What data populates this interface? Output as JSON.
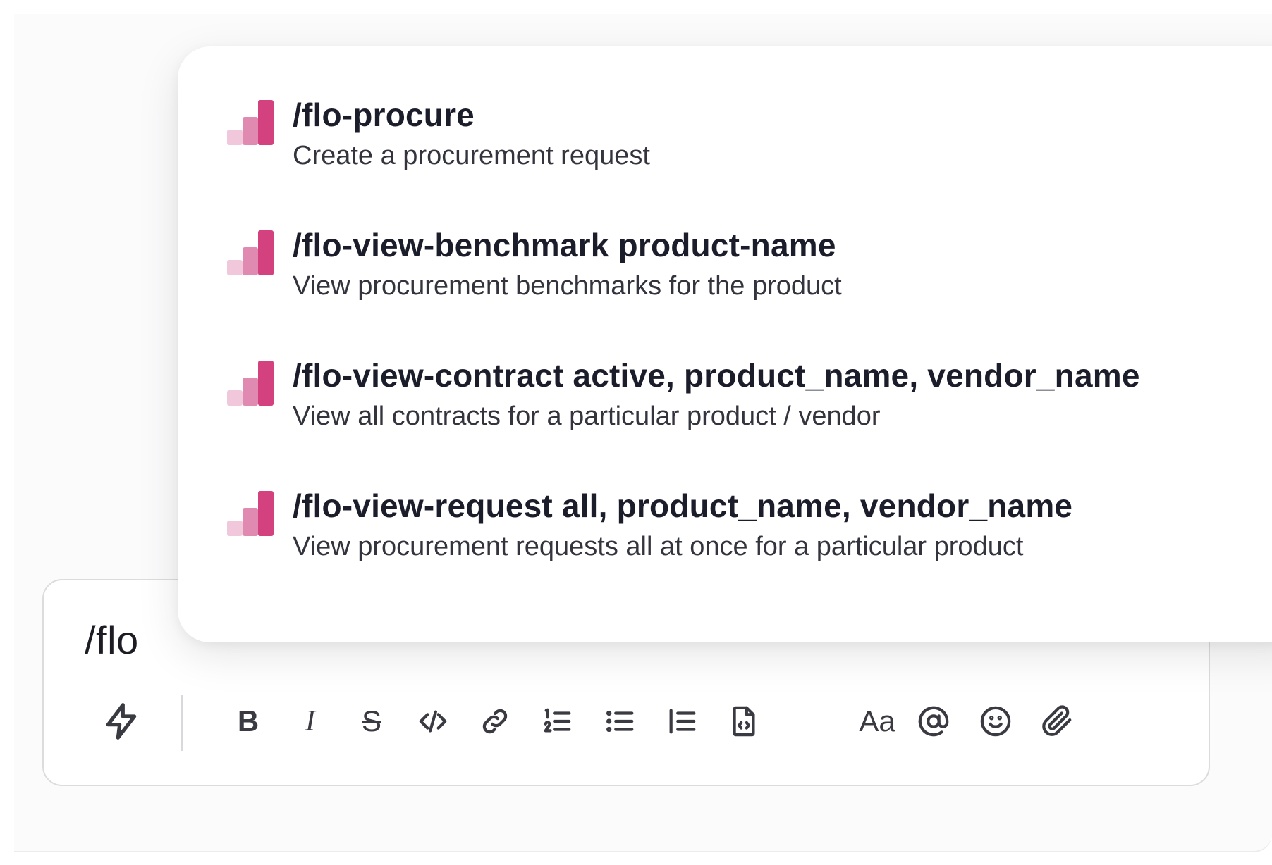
{
  "composer": {
    "input_value": "/flo"
  },
  "commands": [
    {
      "title": "/flo-procure",
      "description": "Create a procurement request"
    },
    {
      "title": "/flo-view-benchmark product-name",
      "description": "View procurement benchmarks for the product"
    },
    {
      "title": "/flo-view-contract active, product_name, vendor_name",
      "description": "View all contracts for a particular product / vendor"
    },
    {
      "title": "/flo-view-request all, product_name, vendor_name",
      "description": "View procurement requests all at once for a particular product"
    }
  ],
  "toolbar": {
    "shortcuts": "lightning-icon",
    "bold_label": "B",
    "italic_label": "I",
    "strike_label": "S",
    "formatting_label": "Aa",
    "icons": [
      "lightning-icon",
      "code-icon",
      "link-icon",
      "ordered-list-icon",
      "bullet-list-icon",
      "blockquote-icon",
      "code-block-icon",
      "mention-icon",
      "emoji-icon",
      "attachment-icon"
    ]
  },
  "colors": {
    "icon_dark": "#d4417f",
    "icon_mid": "#e18ab1",
    "icon_light": "#f1c8db",
    "text_primary": "#1b1d2b"
  }
}
